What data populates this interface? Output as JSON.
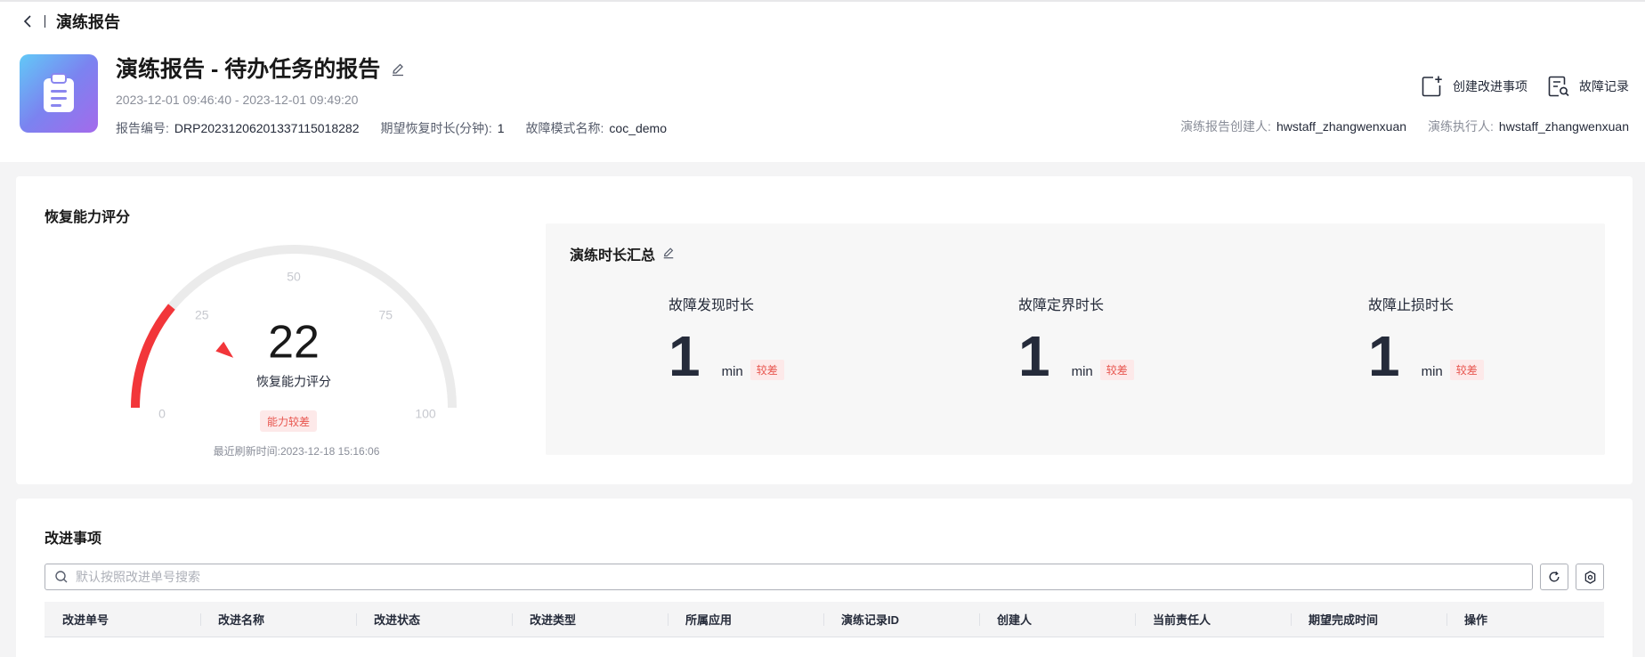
{
  "nav": {
    "title": "演练报告"
  },
  "report": {
    "title": "演练报告 - 待办任务的报告",
    "time_range": "2023-12-01 09:46:40 - 2023-12-01 09:49:20",
    "report_no_label": "报告编号:",
    "report_no": "DRP20231206201337115018282",
    "expected_recovery_label": "期望恢复时长(分钟):",
    "expected_recovery": "1",
    "fault_mode_label": "故障模式名称:",
    "fault_mode": "coc_demo"
  },
  "actions": {
    "create_improvement": "创建改进事项",
    "fault_record": "故障记录"
  },
  "people": {
    "creator_label": "演练报告创建人:",
    "creator": "hwstaff_zhangwenxuan",
    "executor_label": "演练执行人:",
    "executor": "hwstaff_zhangwenxuan"
  },
  "score": {
    "section_title": "恢复能力评分",
    "value": 22,
    "value_text": "22",
    "label": "恢复能力评分",
    "tag": "能力较差",
    "refresh": "最近刷新时间:2023-12-18 15:16:06",
    "ticks": [
      "0",
      "25",
      "50",
      "75",
      "100"
    ],
    "min": 0,
    "max": 100,
    "colors": {
      "active": "#f2363a",
      "track": "#ebebeb",
      "tick": "#c7c9cf"
    }
  },
  "duration": {
    "title": "演练时长汇总",
    "metrics": [
      {
        "label": "故障发现时长",
        "value": "1",
        "unit": "min",
        "tag": "较差"
      },
      {
        "label": "故障定界时长",
        "value": "1",
        "unit": "min",
        "tag": "较差"
      },
      {
        "label": "故障止损时长",
        "value": "1",
        "unit": "min",
        "tag": "较差"
      }
    ]
  },
  "improvement": {
    "section_title": "改进事项",
    "search_placeholder": "默认按照改进单号搜索",
    "columns": [
      "改进单号",
      "改进名称",
      "改进状态",
      "改进类型",
      "所属应用",
      "演练记录ID",
      "创建人",
      "当前责任人",
      "期望完成时间",
      "操作"
    ]
  }
}
